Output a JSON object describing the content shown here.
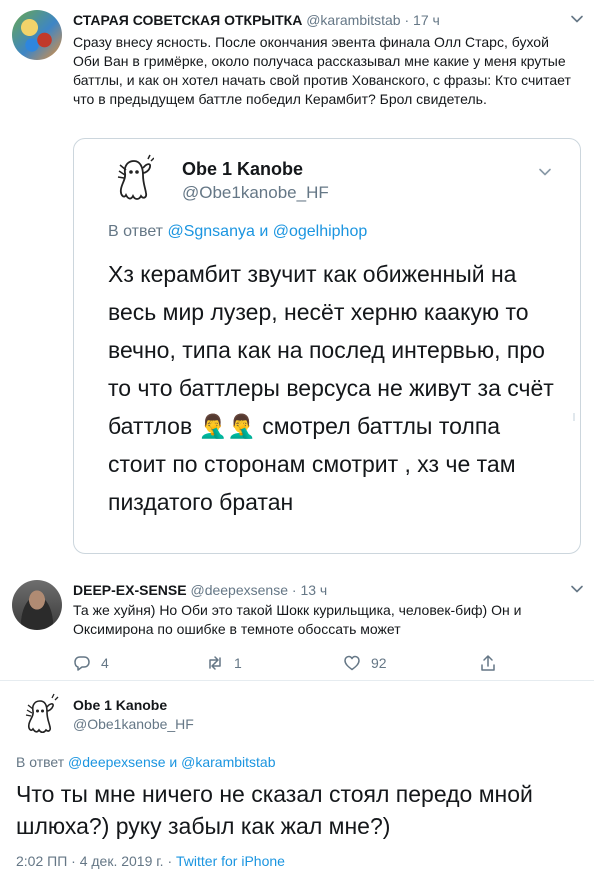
{
  "tweet1": {
    "name": "СТАРАЯ СОВЕТСКАЯ ОТКРЫТКА",
    "handle": "@karambitstab",
    "separator": "·",
    "time": "17 ч",
    "text": "Сразу внесу ясность. После окончания эвента финала Олл Старс, бухой Оби Ван в гримёрке, около получаса рассказывал мне какие у меня крутые баттлы, и как он хотел начать свой против Хованского, с фразы: Кто считает что в предыдущем баттле победил Керамбит? Брол свидетель.",
    "quoted": {
      "name": "Obe 1 Kanobe",
      "handle": "@Obe1kanobe_HF",
      "reply_prefix": "В ответ",
      "reply_to": "@Sgnsanya и @ogelhiphop",
      "text": "Хз керамбит звучит как обиженный на весь мир лузер, несёт херню каакую то вечно, типа как на послед интервью, про то что баттлеры версуса не живут за счёт баттлов 🤦‍♂️🤦‍♂️ смотрел баттлы толпа стоит по сторонам смотрит , хз че там пиздатого братан"
    }
  },
  "tweet2": {
    "name": "DEEP-EX-SENSE",
    "handle": "@deepexsense",
    "separator": "·",
    "time": "13 ч",
    "text": "Та же хуйня) Но Оби это такой Шокк курильщика, человек-биф) Он и Оксимирона по ошибке в темноте обоссать может",
    "actions": {
      "reply_count": "4",
      "retweet_count": "1",
      "like_count": "92"
    }
  },
  "tweet3": {
    "name": "Obe 1 Kanobe",
    "handle": "@Obe1kanobe_HF",
    "reply_prefix": "В ответ",
    "reply_to": "@deepexsense и @karambitstab",
    "text": "Что ты мне ничего не сказал стоял передо мной шлюха?) руку забыл как жал мне?)",
    "timestamp": "2:02 ПП · 4 дек. 2019 г. ·",
    "source": "Twitter for iPhone"
  },
  "colors": {
    "link": "#1b95e0",
    "muted": "#657786",
    "text": "#14171a",
    "border": "#ccd6dd"
  },
  "icons": [
    "chevron-down-icon",
    "reply-icon",
    "retweet-icon",
    "like-icon",
    "share-icon"
  ]
}
